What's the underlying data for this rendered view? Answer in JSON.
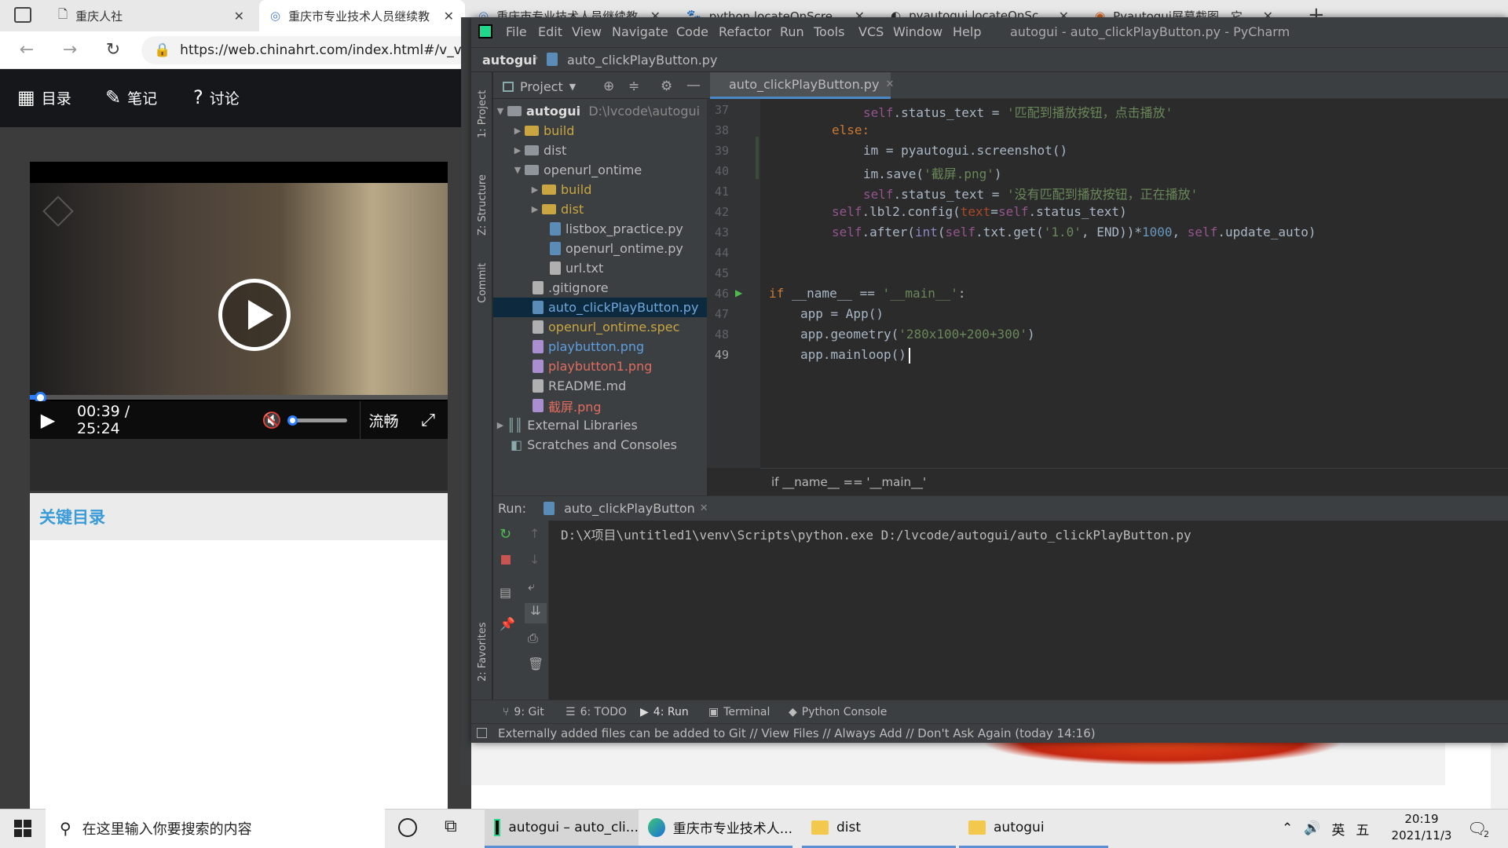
{
  "browser": {
    "tabs": [
      {
        "title": "重庆人社"
      },
      {
        "title": "重庆市专业技术人员继续教"
      },
      {
        "title": "重庆市专业技术人员继续教"
      },
      {
        "title": "python locateOnScreen匹配"
      },
      {
        "title": "pyautogui.locateOnScreen("
      },
      {
        "title": "Pyautogui屏幕截图，它去看"
      }
    ],
    "url": "https://web.chinahrt.com/index.html#/v_video?"
  },
  "site": {
    "nav": [
      "目录",
      "笔记",
      "讨论"
    ],
    "video": {
      "time": "00:39 / 25:24",
      "quality": "流畅",
      "progress": 0.026,
      "volume": 0.08
    },
    "key_title": "关键目录"
  },
  "pycharm": {
    "menu": [
      "File",
      "Edit",
      "View",
      "Navigate",
      "Code",
      "Refactor",
      "Run",
      "Tools",
      "VCS",
      "Window",
      "Help"
    ],
    "window_title": "autogui - auto_clickPlayButton.py - PyCharm",
    "nav": {
      "project": "autogui",
      "file": "auto_clickPlayButton.py"
    },
    "left_strip": [
      "1: Project",
      "Z: Structure",
      "Commit",
      "2: Favorites"
    ],
    "project_label": "Project",
    "tree": [
      {
        "label": "autogui",
        "extra": "D:\\lvcode\\autogui"
      },
      {
        "label": "build"
      },
      {
        "label": "dist"
      },
      {
        "label": "openurl_ontime"
      },
      {
        "label": "build"
      },
      {
        "label": "dist"
      },
      {
        "label": "listbox_practice.py"
      },
      {
        "label": "openurl_ontime.py"
      },
      {
        "label": "url.txt"
      },
      {
        "label": ".gitignore"
      },
      {
        "label": "auto_clickPlayButton.py"
      },
      {
        "label": "openurl_ontime.spec"
      },
      {
        "label": "playbutton.png"
      },
      {
        "label": "playbutton1.png"
      },
      {
        "label": "README.md"
      },
      {
        "label": "截屏.png"
      },
      {
        "label": "External Libraries"
      },
      {
        "label": "Scratches and Consoles"
      }
    ],
    "editor_tab": "auto_clickPlayButton.py",
    "line_numbers": [
      "37",
      "38",
      "39",
      "40",
      "41",
      "42",
      "43",
      "44",
      "45",
      "46",
      "47",
      "48",
      "49"
    ],
    "code": {
      "l37a": "self",
      "l37b": ".status_text = ",
      "l37c": "'匹配到播放按钮，点击播放'",
      "l38": "else:",
      "l39": "im = pyautogui.screenshot()",
      "l40a": "im.save(",
      "l40b": "'截屏.png'",
      "l40c": ")",
      "l41a": "self",
      "l41b": ".status_text = ",
      "l41c": "'没有匹配到播放按钮，正在播放'",
      "l42a": "self",
      "l42b": ".lbl2.config(",
      "l42c": "text",
      "l42d": "=",
      "l42e": "self",
      "l42f": ".status_text)",
      "l43a": "self",
      "l43b": ".after(",
      "l43c": "int",
      "l43d": "(",
      "l43e": "self",
      "l43f": ".txt.get(",
      "l43g": "'1.0'",
      "l43h": ", END))*",
      "l43i": "1000",
      "l43j": ", ",
      "l43k": "self",
      "l43l": ".update_auto)",
      "l46a": "if",
      "l46b": " __name__ == ",
      "l46c": "'__main__'",
      "l46d": ":",
      "l47": "app = App()",
      "l48a": "app.geometry(",
      "l48b": "'280x100+200+300'",
      "l48c": ")",
      "l49": "app.mainloop()"
    },
    "breadcrumb": "if __name__ == '__main__'",
    "run": {
      "label": "Run:",
      "tab": "auto_clickPlayButton",
      "output": "D:\\X项目\\untitled1\\venv\\Scripts\\python.exe D:/lvcode/autogui/auto_clickPlayButton.py"
    },
    "toolwindows": [
      "9: Git",
      "6: TODO",
      "4: Run",
      "Terminal",
      "Python Console"
    ],
    "status": "Externally added files can be added to Git // View Files // Always Add // Don't Ask Again (today 14:16)"
  },
  "taskbar": {
    "search_placeholder": "在这里输入你要搜索的内容",
    "apps": [
      "autogui – auto_cli...",
      "重庆市专业技术人...",
      "dist",
      "autogui"
    ],
    "tray_ime": "英",
    "tray_mode": "五",
    "time": "20:19",
    "date": "2021/11/3",
    "notif_count": "2"
  },
  "colors": {
    "pycharm_bg": "#2b2b2b",
    "pycharm_panel": "#3c3f41",
    "keyword": "#cc7832",
    "string": "#6a8759",
    "self": "#94558d",
    "number": "#6897bb",
    "accent_blue": "#2b7cff",
    "site_title": "#3a9bd9"
  }
}
